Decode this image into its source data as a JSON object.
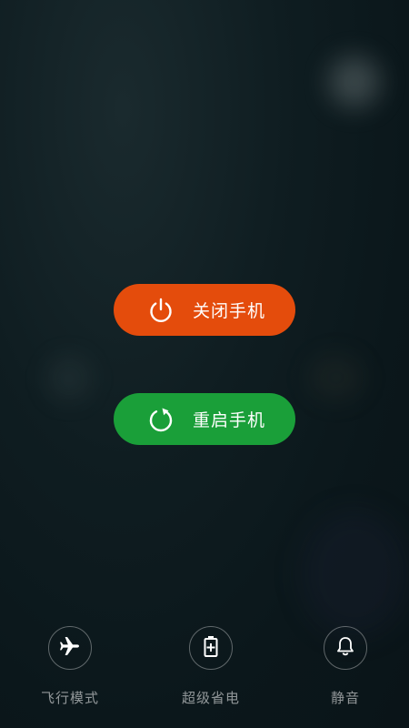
{
  "power_menu": {
    "shutdown": {
      "label": "关闭手机",
      "color": "#e44c0c",
      "icon": "power-icon"
    },
    "restart": {
      "label": "重启手机",
      "color": "#1a9f39",
      "icon": "restart-icon"
    }
  },
  "quick_actions": [
    {
      "label": "飞行模式",
      "icon": "airplane-icon"
    },
    {
      "label": "超级省电",
      "icon": "battery-plus-icon"
    },
    {
      "label": "静音",
      "icon": "bell-icon"
    }
  ]
}
